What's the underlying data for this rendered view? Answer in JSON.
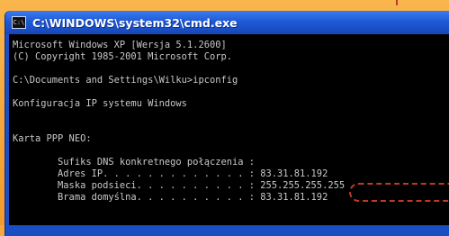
{
  "window": {
    "title": "C:\\WINDOWS\\system32\\cmd.exe",
    "icon_label": "C:\\"
  },
  "console": {
    "lines": [
      "Microsoft Windows XP [Wersja 5.1.2600]",
      "(C) Copyright 1985-2001 Microsoft Corp.",
      "",
      "C:\\Documents and Settings\\Wilku>ipconfig",
      "",
      "Konfiguracja IP systemu Windows",
      "",
      "",
      "Karta PPP NEO:",
      "",
      "        Sufiks DNS konkretnego połączenia :",
      "        Adres IP. . . . . . . . . . . . . : 83.31.81.192",
      "        Maska podsieci. . . . . . . . . . : 255.255.255.255",
      "        Brama domyślna. . . . . . . . . . : 83.31.81.192"
    ]
  },
  "colors": {
    "background": "#f6a83c",
    "titlebar": "#1f5ad6",
    "console_text": "#c8c8c8",
    "highlight": "#c0392b"
  }
}
